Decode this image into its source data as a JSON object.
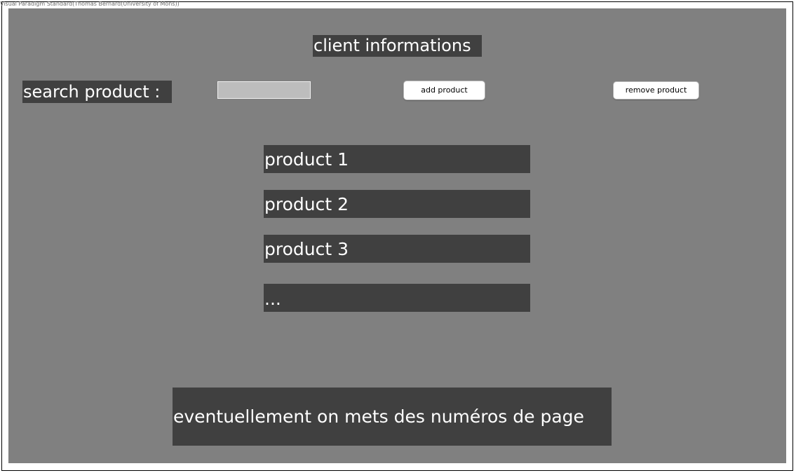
{
  "watermark": "Visual Paradigm Standard(Thomas Bernard(University of Mons))",
  "title": "client informations",
  "search": {
    "label": "search product :",
    "value": ""
  },
  "buttons": {
    "add": "add product",
    "remove": "remove product"
  },
  "products": [
    "product 1",
    "product 2",
    "product 3",
    "..."
  ],
  "pagination_note": "eventuellement on mets des numéros de page",
  "colors": {
    "background": "#808080",
    "label_background": "#404040",
    "label_text": "#ffffff",
    "input_background": "#bdbdbd",
    "button_background": "#ffffff"
  }
}
